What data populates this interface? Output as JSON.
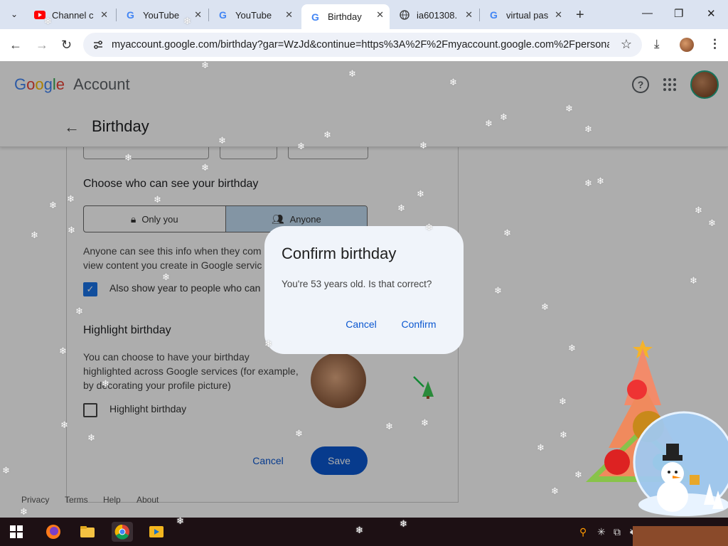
{
  "browser": {
    "tabs": [
      {
        "title": "Channel c",
        "icon": "youtube-icon",
        "active": false
      },
      {
        "title": "YouTube",
        "icon": "google-icon",
        "active": false
      },
      {
        "title": "YouTube",
        "icon": "google-icon",
        "active": false
      },
      {
        "title": "Birthday",
        "icon": "google-icon",
        "active": true
      },
      {
        "title": "ia601308.",
        "icon": "globe-icon",
        "active": false
      },
      {
        "title": "virtual pas",
        "icon": "google-icon",
        "active": false
      }
    ],
    "url": "myaccount.google.com/birthday?gar=WzJd&continue=https%3A%2F%2Fmyaccount.google.com%2Fpersonal-i..."
  },
  "header": {
    "logo": "Google",
    "logo_suffix": "Account",
    "back_label": "←",
    "page_title": "Birthday"
  },
  "visibility": {
    "heading": "Choose who can see your birthday",
    "option_only_you": "Only you",
    "option_anyone": "Anyone",
    "selected": "Anyone",
    "description_line1": "Anyone can see this info when they com",
    "description_line2": "view content you create in Google servic",
    "show_year_label": "Also show year to people who can",
    "show_year_checked": true
  },
  "highlight": {
    "heading": "Highlight birthday",
    "description_line1": "You can choose to have your birthday",
    "description_line2": "highlighted across Google services (for example,",
    "description_line3": "by decorating your profile picture)",
    "checkbox_label": "Highlight birthday",
    "checked": false
  },
  "actions": {
    "cancel": "Cancel",
    "save": "Save"
  },
  "footer": {
    "links": [
      "Privacy",
      "Terms",
      "Help",
      "About"
    ]
  },
  "dialog": {
    "title": "Confirm birthday",
    "message": "You're 53 years old. Is that correct?",
    "cancel": "Cancel",
    "confirm": "Confirm"
  },
  "colors": {
    "accent": "#0b57d0",
    "selected_segment": "#c2dcf2"
  }
}
